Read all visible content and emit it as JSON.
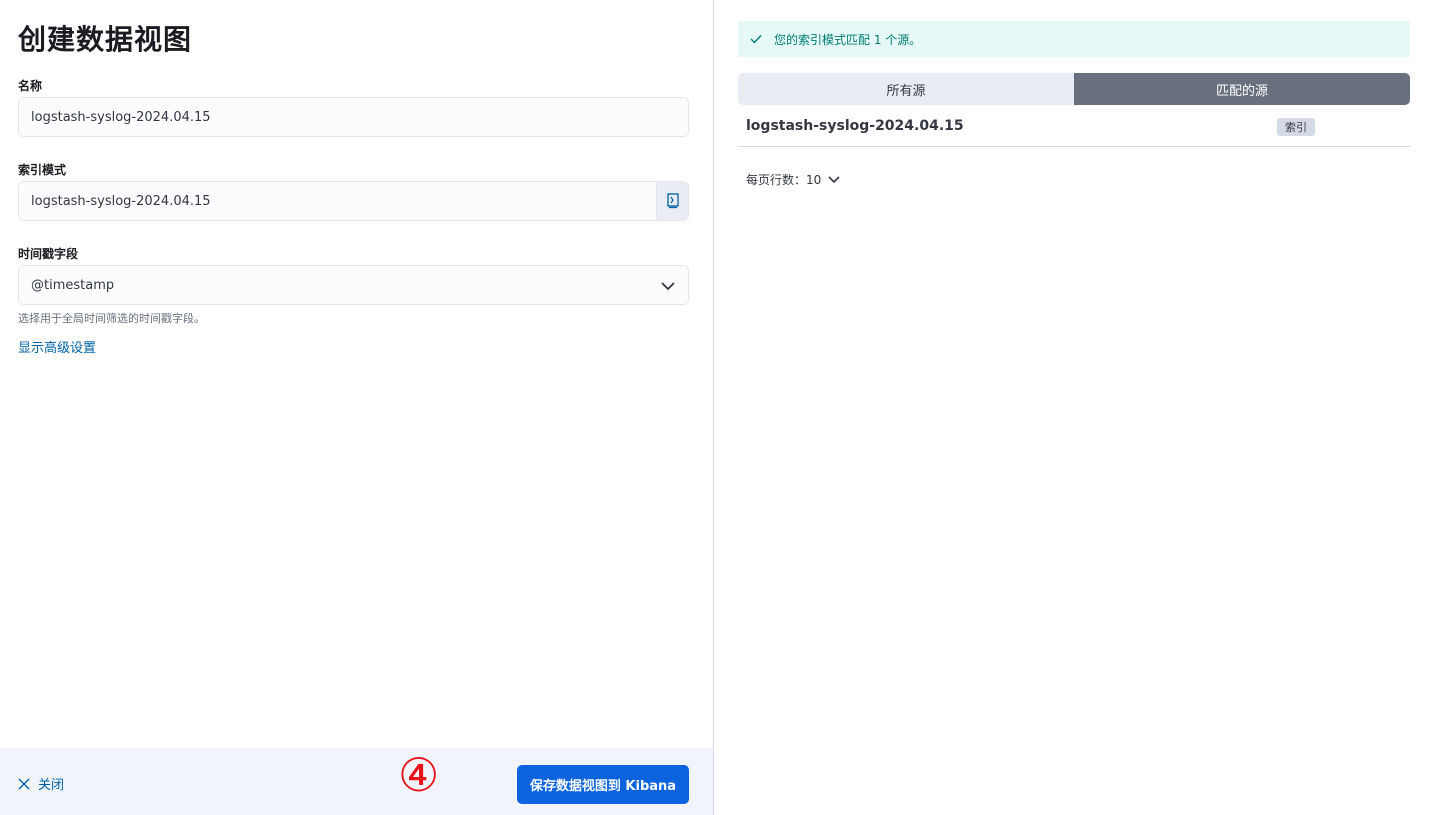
{
  "left": {
    "title": "创建数据视图",
    "name_field": {
      "label": "名称",
      "value": "logstash-syslog-2024.04.15"
    },
    "index_pattern_field": {
      "label": "索引模式",
      "value": "logstash-syslog-2024.04.15"
    },
    "timestamp_field": {
      "label": "时间戳字段",
      "value": "@timestamp",
      "help": "选择用于全局时间筛选的时间戳字段。"
    },
    "advanced_link": "显示高级设置"
  },
  "footer": {
    "close_label": "关闭",
    "annotation": "④",
    "save_label": "保存数据视图到 Kibana"
  },
  "right": {
    "callout": "您的索引模式匹配 1 个源。",
    "tabs": [
      {
        "label": "所有源",
        "selected": false
      },
      {
        "label": "匹配的源",
        "selected": true
      }
    ],
    "rows": [
      {
        "name": "logstash-syslog-2024.04.15",
        "badge": "索引"
      }
    ],
    "rows_per_page_label": "每页行数：10"
  },
  "colors": {
    "primary": "#0b64dd",
    "link": "#0061a6",
    "success_bg": "#e6f9f7",
    "success_text": "#017d73",
    "tab_selected": "#69707d",
    "annotation_red": "#e8121b"
  },
  "icons": [
    "check-icon",
    "copy-index-icon",
    "chevron-down-icon",
    "close-icon"
  ]
}
